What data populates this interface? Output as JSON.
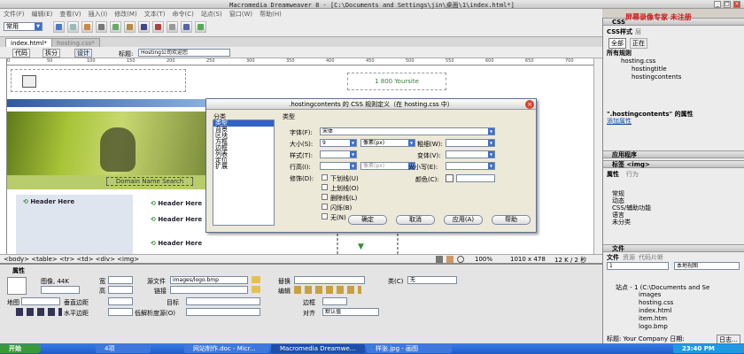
{
  "window": {
    "title": "Macromedia Dreamweaver 8 - [C:\\Documents and Settings\\jin\\桌面\\1\\index.html*]",
    "watermark": "屏幕录像专家 未注册"
  },
  "menu": [
    "文件(F)",
    "编辑(E)",
    "查看(V)",
    "插入(I)",
    "修改(M)",
    "文本(T)",
    "命令(C)",
    "站点(S)",
    "窗口(W)",
    "帮助(H)"
  ],
  "insertbar": {
    "category": "常用"
  },
  "doc_tabs": [
    "index.html*",
    "hosting.css*"
  ],
  "view_buttons": {
    "code": "代码",
    "split": "拆分",
    "design": "设计"
  },
  "doc_title": {
    "label": "标题:",
    "value": "Hosting公司欢迎您"
  },
  "ruler_ticks": [
    "0",
    "50",
    "100",
    "150",
    "200",
    "250",
    "300",
    "350",
    "400",
    "450",
    "500",
    "550",
    "600",
    "650",
    "700"
  ],
  "design": {
    "phone": "1 800 Yoursite",
    "domain_search": "Domain Name Search",
    "headers": [
      "Header Here",
      "Header Here",
      "Header Here",
      "Header Here"
    ]
  },
  "status": {
    "tags": "<body> <table> <tr> <td> <div> <img>",
    "zoom": "100%",
    "size": "1010 x 478",
    "weight": "12 K / 2 秒"
  },
  "properties": {
    "section_title": "属性",
    "kind": "图像, 44K",
    "w_label": "宽",
    "h_label": "高",
    "src_label": "源文件",
    "src_value": "images/logo.bmp",
    "link_label": "链接",
    "alt_label": "替换",
    "edit_label": "编辑",
    "class_label": "类(C)",
    "class_value": "无",
    "map_label": "地图",
    "vspace_label": "垂直边距",
    "hspace_label": "水平边距",
    "target_label": "目标",
    "lowsrc_label": "低解析度源(O)",
    "border_label": "边框",
    "align_label": "对齐",
    "align_value": "默认值"
  },
  "dialog": {
    "title": ".hostingcontents 的 CSS 规则定义（在 hosting.css 中）",
    "category_title": "分类",
    "categories": [
      "类型",
      "背景",
      "区块",
      "方框",
      "边框",
      "列表",
      "定位",
      "扩展"
    ],
    "section_title": "类型",
    "font_label": "字体(F):",
    "font_value": "宋体",
    "size_label": "大小(S):",
    "size_value": "9",
    "unit_value": "像素(px)",
    "weight_label": "粗细(W):",
    "style_label": "样式(T):",
    "variant_label": "变体(V):",
    "line_height_label": "行高(I):",
    "line_unit": "像素(px)",
    "case_label": "大小写(E):",
    "decoration_label": "修饰(D):",
    "decorations": [
      "下划线(U)",
      "上划线(O)",
      "删除线(L)",
      "闪烁(B)",
      "无(N)"
    ],
    "color_label": "颜色(C):",
    "buttons": {
      "ok": "确定",
      "cancel": "取消",
      "apply": "应用(A)",
      "help": "帮助"
    }
  },
  "right_panel": {
    "css_header": "CSS",
    "css_tabs": {
      "css_styles": "CSS样式",
      "layers": "层"
    },
    "mode": {
      "all": "全部",
      "current": "正在"
    },
    "all_rules": "所有规则",
    "rules": [
      "hosting.css",
      "hostingtitle",
      "hostingcontents"
    ],
    "props_of": "\".hostingcontents\" 的属性",
    "add_prop": "添加属性",
    "app_header": "应用程序",
    "tag_header": "标签 <img>",
    "tag_tabs": {
      "attributes": "属性",
      "behaviors": "行为"
    },
    "tag_groups": [
      "常规",
      "动态",
      "CSS/辅助功能",
      "语言",
      "未分类"
    ],
    "files_header": "文件",
    "files_tabs": {
      "files": "文件",
      "assets": "资源",
      "snippets": "代码片断"
    },
    "site_select": "1",
    "view_select": "本地视图",
    "tree": [
      "站点 - 1 (C:\\Documents and Se",
      "images",
      "hosting.css",
      "index.html",
      "item.htm",
      "logo.bmp"
    ],
    "files_status": "标题: Your Company 日期:",
    "log": "日志..."
  },
  "taskbar": {
    "start": "开始",
    "items": [
      "4项",
      "网站制作.doc - Micr...",
      "Macromedia Dreamwe...",
      "样张.jpg - 画图"
    ],
    "clock": "23:40 PM"
  }
}
